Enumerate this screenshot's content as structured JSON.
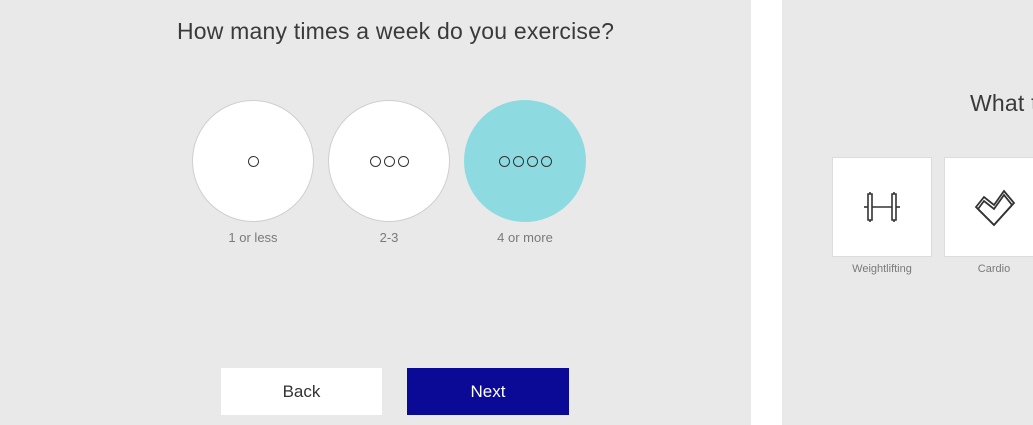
{
  "left_panel": {
    "question": "How many times a week do you exercise?",
    "options": [
      {
        "label": "1 or less",
        "icon": "one-dot-icon",
        "selected": false
      },
      {
        "label": "2-3",
        "icon": "three-dots-icon",
        "selected": false
      },
      {
        "label": "4 or more",
        "icon": "four-dots-icon",
        "selected": true
      }
    ],
    "back_label": "Back",
    "next_label": "Next"
  },
  "right_panel": {
    "question": "What t",
    "tiles": [
      {
        "label": "Weightlifting",
        "icon": "dumbbell-icon"
      },
      {
        "label": "Cardio",
        "icon": "heart-icon"
      }
    ]
  },
  "colors": {
    "panel_background": "#e9e9e9",
    "selected_option": "#8ddbe0",
    "next_button": "#0a0a96"
  }
}
